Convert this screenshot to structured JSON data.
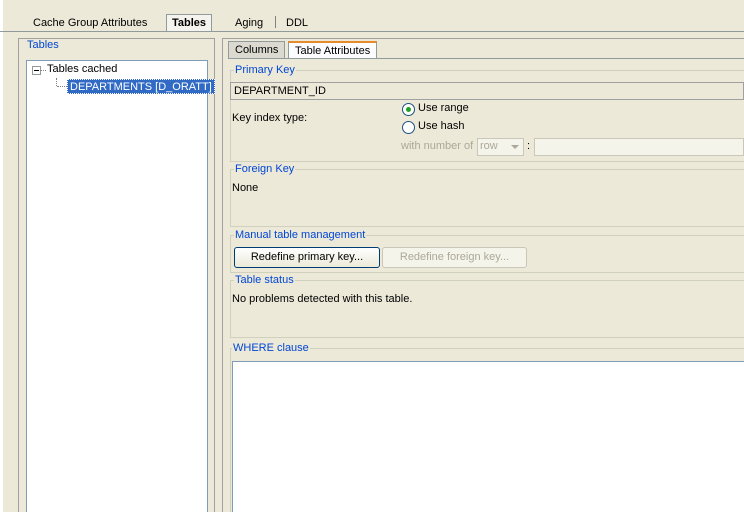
{
  "top_tabs": [
    {
      "label": "Cache Group Attributes",
      "active": false
    },
    {
      "label": "Tables",
      "active": true
    },
    {
      "label": "Aging",
      "active": false
    },
    {
      "label": "DDL",
      "active": false
    }
  ],
  "left": {
    "group_title": "Tables",
    "tree": {
      "root_label": "Tables cached",
      "children": [
        {
          "label": "DEPARTMENTS [D_ORATT]",
          "selected": true
        }
      ]
    }
  },
  "sub_tabs": [
    {
      "label": "Columns",
      "active": false
    },
    {
      "label": "Table Attributes",
      "active": true
    }
  ],
  "primary_key": {
    "title": "Primary Key",
    "value": "DEPARTMENT_ID",
    "key_index_label": "Key index type:",
    "options": [
      {
        "label": "Use range",
        "checked": true
      },
      {
        "label": "Use hash",
        "checked": false
      }
    ],
    "with_number_label": "with number of",
    "select_value": "row",
    "colon": ":"
  },
  "foreign_key": {
    "title": "Foreign Key",
    "value": "None"
  },
  "manual": {
    "title": "Manual table management",
    "redefine_primary": "Redefine primary key...",
    "redefine_foreign": "Redefine foreign key..."
  },
  "status": {
    "title": "Table status",
    "text": "No problems detected with this table."
  },
  "where": {
    "title": "WHERE clause",
    "value": ""
  },
  "colors": {
    "legend": "#0046d5",
    "selection": "#316ac5",
    "active_tab_accent": "#e68b2c"
  }
}
